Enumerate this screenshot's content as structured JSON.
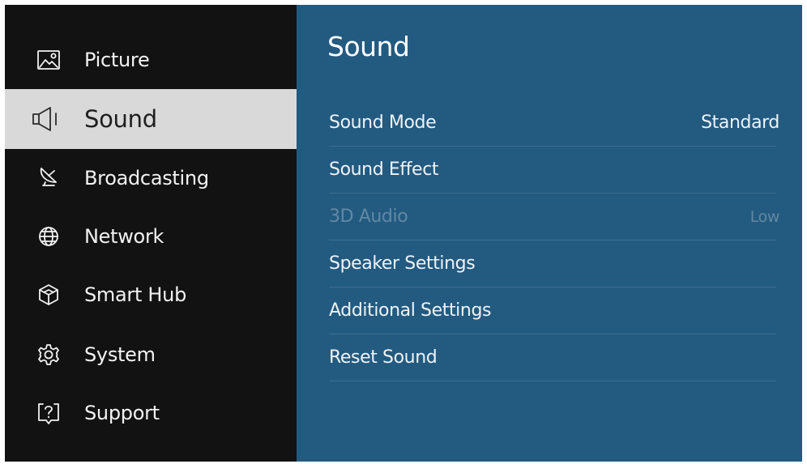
{
  "sidebar": {
    "items": [
      {
        "label": "Picture",
        "icon": "picture-icon",
        "active": false
      },
      {
        "label": "Sound",
        "icon": "speaker-icon",
        "active": true
      },
      {
        "label": "Broadcasting",
        "icon": "satellite-dish-icon",
        "active": false
      },
      {
        "label": "Network",
        "icon": "globe-icon",
        "active": false
      },
      {
        "label": "Smart Hub",
        "icon": "cube-icon",
        "active": false
      },
      {
        "label": "System",
        "icon": "gear-icon",
        "active": false
      },
      {
        "label": "Support",
        "icon": "help-bubble-icon",
        "active": false
      }
    ]
  },
  "main": {
    "title": "Sound",
    "menu": [
      {
        "label": "Sound Mode",
        "value": "Standard",
        "enabled": true
      },
      {
        "label": "Sound Effect",
        "value": "",
        "enabled": true
      },
      {
        "label": "3D Audio",
        "value": "Low",
        "enabled": false
      },
      {
        "label": "Speaker Settings",
        "value": "",
        "enabled": true
      },
      {
        "label": "Additional Settings",
        "value": "",
        "enabled": true
      },
      {
        "label": "Reset Sound",
        "value": "",
        "enabled": true
      }
    ]
  },
  "colors": {
    "sidebar_bg": "#121212",
    "active_item_bg": "#d9d9d9",
    "main_bg": "#235a80",
    "text_primary": "#f2f2f2",
    "text_disabled": "rgba(255,255,255,0.28)"
  }
}
